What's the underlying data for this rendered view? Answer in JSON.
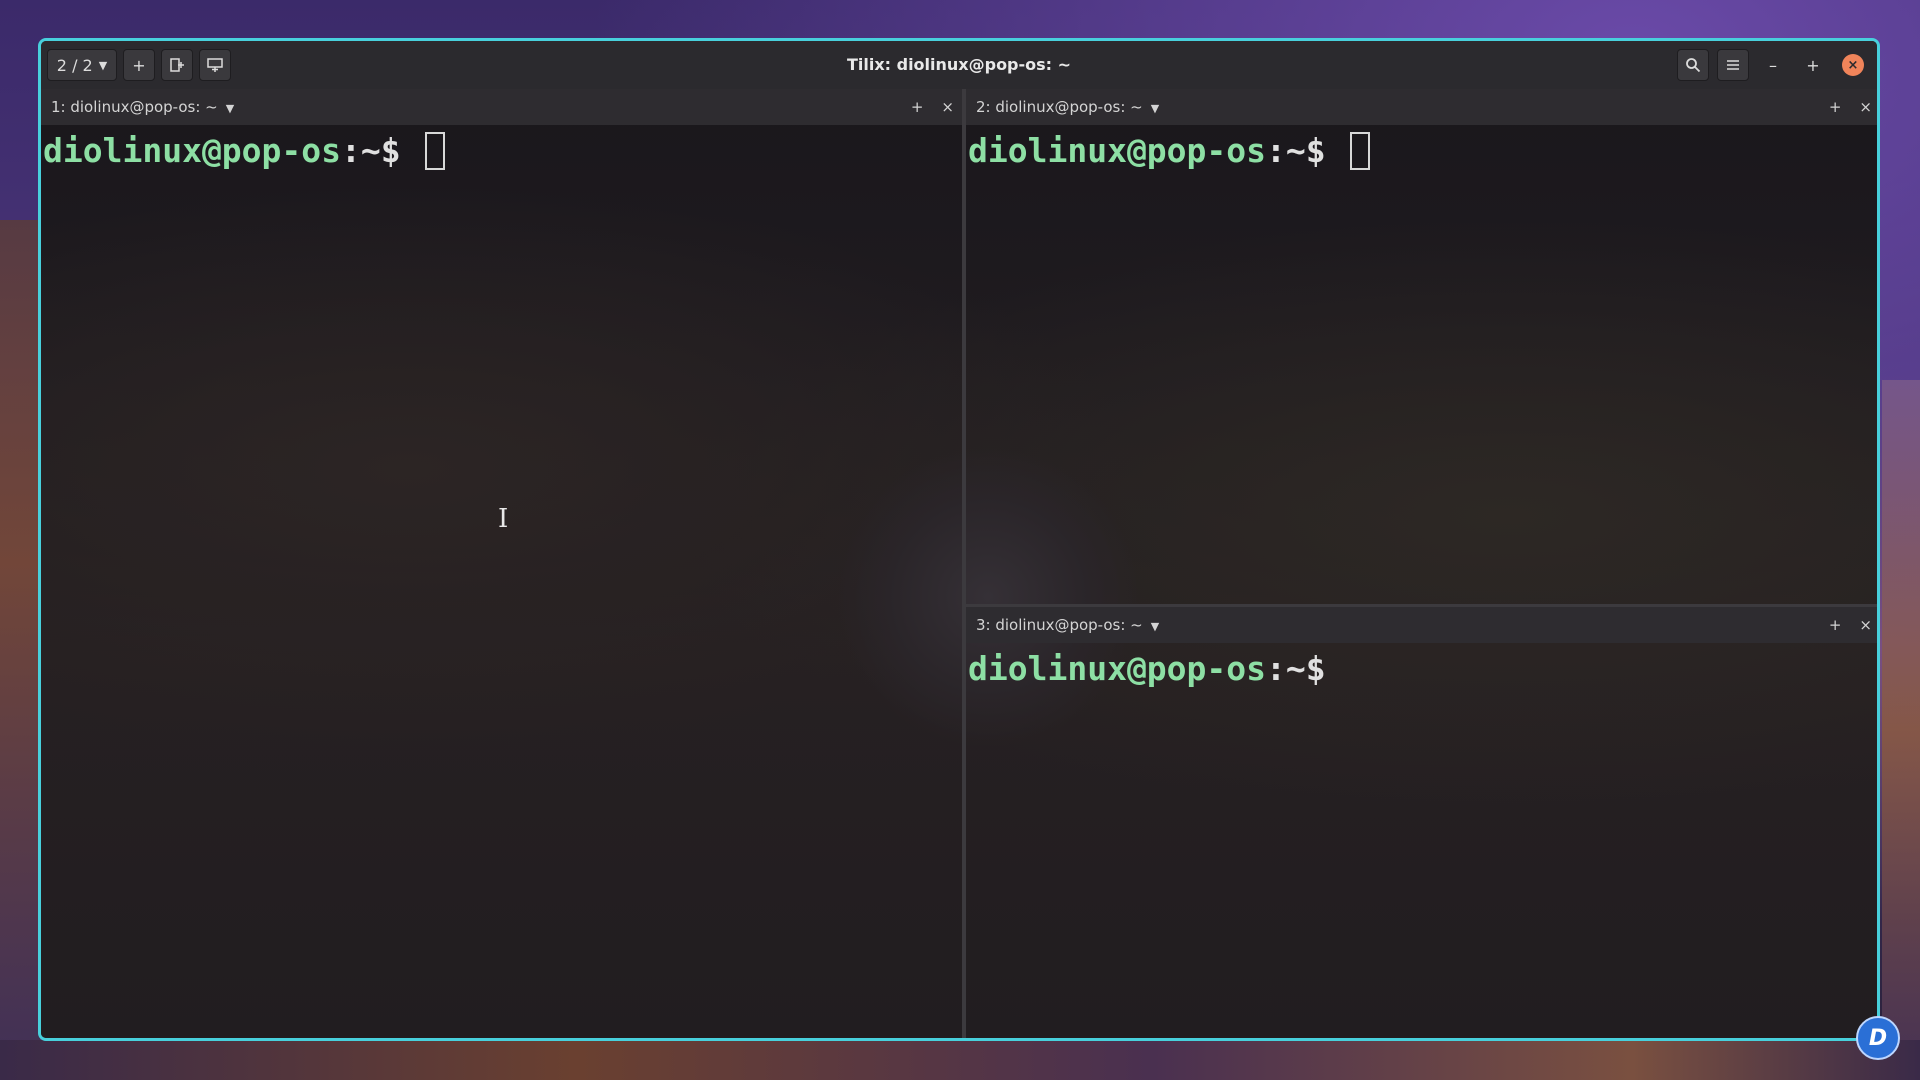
{
  "window": {
    "title": "Tilix: diolinux@pop-os: ~"
  },
  "toolbar": {
    "session_indicator": "2 / 2",
    "add_label": "+",
    "minimize_label": "–",
    "maximize_label": "+",
    "close_label": "×"
  },
  "panes": [
    {
      "title": "1: diolinux@pop-os: ~",
      "add_label": "+",
      "close_label": "×",
      "prompt_user": "diolinux@pop-os",
      "prompt_path": ":~$ "
    },
    {
      "title": "2: diolinux@pop-os: ~",
      "add_label": "+",
      "close_label": "×",
      "prompt_user": "diolinux@pop-os",
      "prompt_path": ":~$ "
    },
    {
      "title": "3: diolinux@pop-os: ~",
      "add_label": "+",
      "close_label": "×",
      "prompt_user": "diolinux@pop-os",
      "prompt_path": ":~$"
    }
  ],
  "badge": {
    "letter": "D"
  },
  "colors": {
    "accent_border": "#48d0dc",
    "prompt_green": "#8ddfa4",
    "close_button": "#f0845a"
  },
  "icons": {
    "session_dropdown": "chevron-down-icon",
    "new_session": "plus-icon",
    "add_terminal_right": "add-right-icon",
    "add_terminal_down": "add-down-icon",
    "search": "search-icon",
    "menu": "hamburger-menu-icon",
    "pane_menu": "chevron-down-icon"
  }
}
